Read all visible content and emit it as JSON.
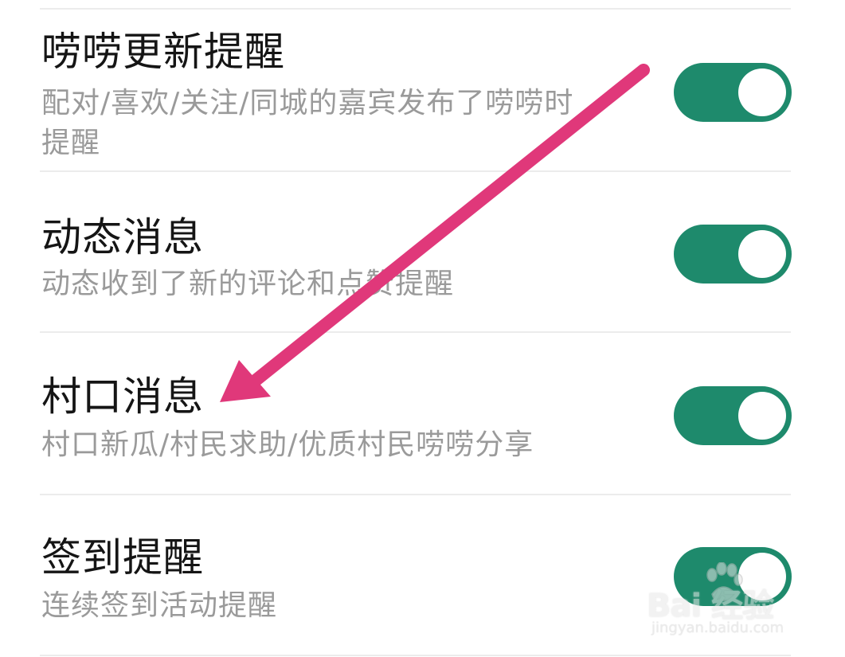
{
  "settings": [
    {
      "title": "唠唠更新提醒",
      "description": "配对/喜欢/关注/同城的嘉宾发布了唠唠时提醒",
      "enabled": true
    },
    {
      "title": "动态消息",
      "description": "动态收到了新的评论和点赞提醒",
      "enabled": true
    },
    {
      "title": "村口消息",
      "description": "村口新瓜/村民求助/优质村民唠唠分享",
      "enabled": true
    },
    {
      "title": "签到提醒",
      "description": "连续签到活动提醒",
      "enabled": true
    }
  ],
  "colors": {
    "toggle_on": "#1e8a6c",
    "arrow": "#e0387a",
    "title_text": "#151515",
    "description_text": "#9a9a9a"
  },
  "watermark": {
    "brand": "Bai  经验",
    "url": "jingyan.baidu.com"
  }
}
